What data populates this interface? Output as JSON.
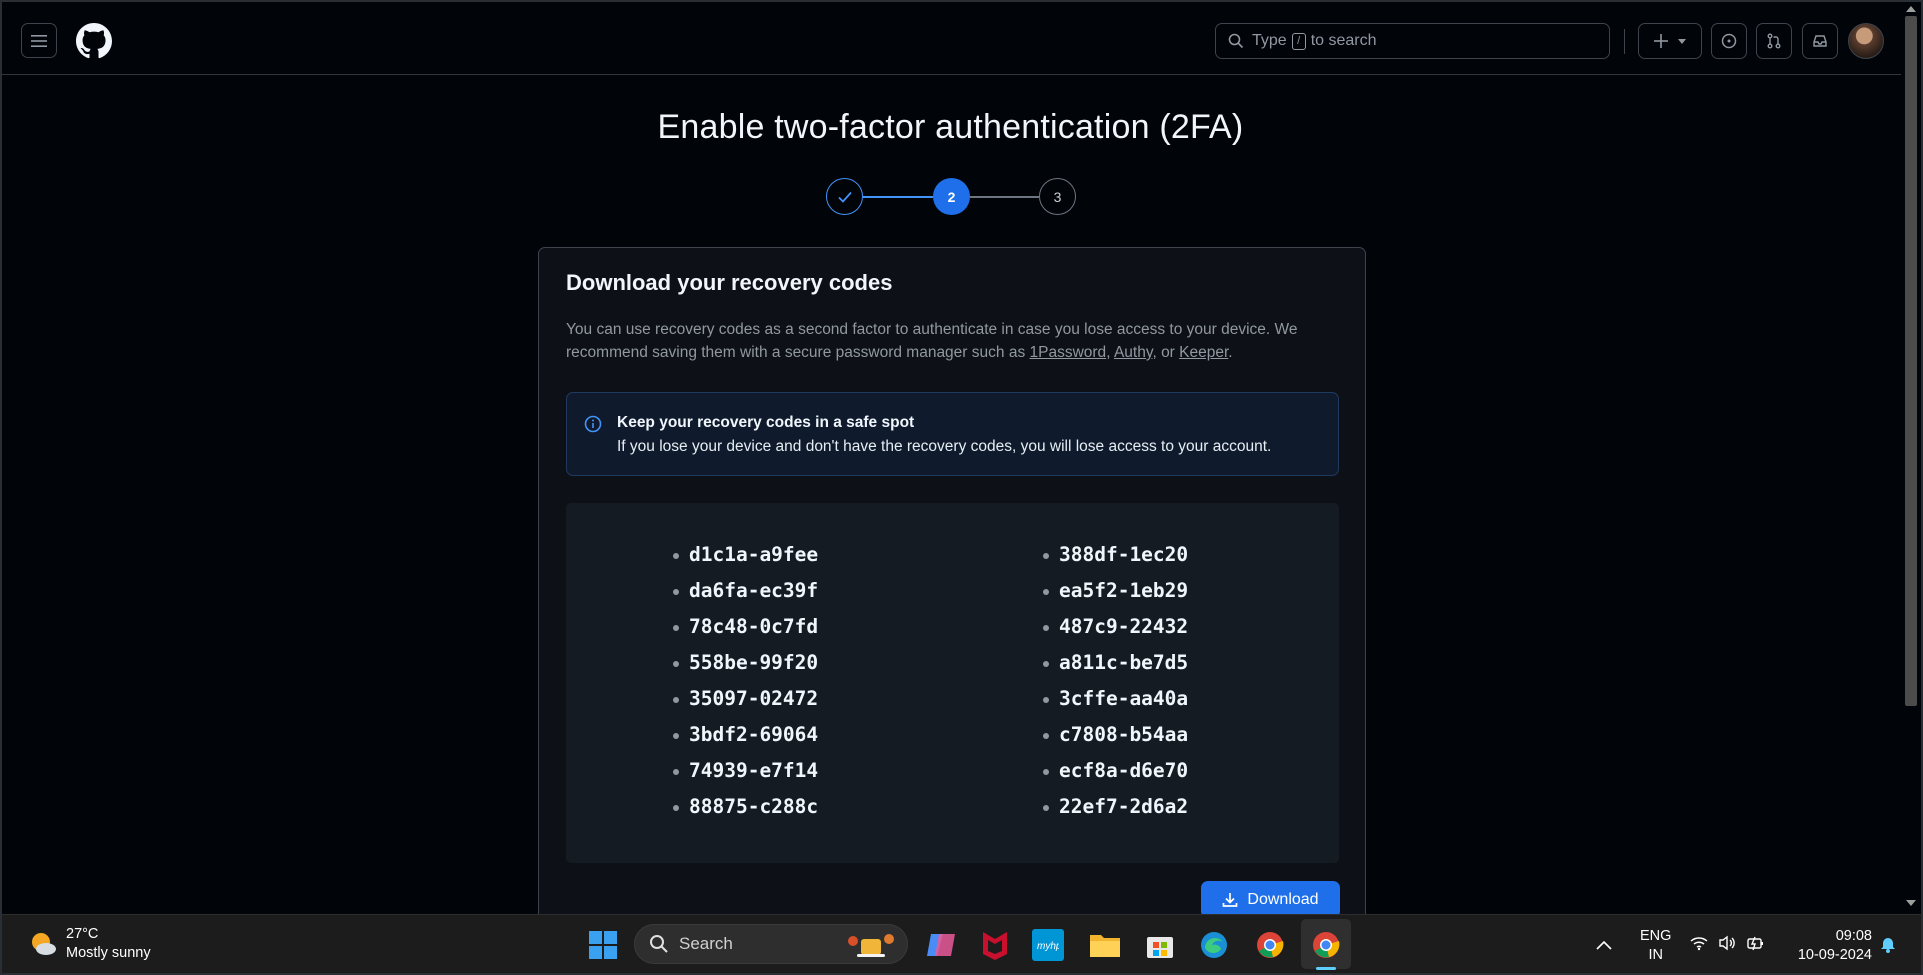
{
  "header": {
    "search_placeholder_pre": "Type",
    "search_slash": "/",
    "search_placeholder_post": "to search"
  },
  "page": {
    "title": "Enable two-factor authentication (2FA)",
    "steps": [
      {
        "label": "",
        "state": "completed"
      },
      {
        "label": "2",
        "state": "current"
      },
      {
        "label": "3",
        "state": "upcoming"
      }
    ]
  },
  "card": {
    "title": "Download your recovery codes",
    "desc_part1": "You can use recovery codes as a second factor to authenticate in case you lose access to your device. We recommend saving them with a secure password manager such as ",
    "link_1password": "1Password",
    "sep1": ", ",
    "link_authy": "Authy",
    "sep2": ", or ",
    "link_keeper": "Keeper",
    "desc_end": ".",
    "flash_title": "Keep your recovery codes in a safe spot",
    "flash_text": "If you lose your device and don't have the recovery codes, you will lose access to your account.",
    "codes_left": [
      "d1c1a-a9fee",
      "da6fa-ec39f",
      "78c48-0c7fd",
      "558be-99f20",
      "35097-02472",
      "3bdf2-69064",
      "74939-e7f14",
      "88875-c288c"
    ],
    "codes_right": [
      "388df-1ec20",
      "ea5f2-1eb29",
      "487c9-22432",
      "a811c-be7d5",
      "3cffe-aa40a",
      "c7808-b54aa",
      "ecf8a-d6e70",
      "22ef7-2d6a2"
    ],
    "download_label": "Download"
  },
  "taskbar": {
    "weather_temp": "27°C",
    "weather_desc": "Mostly sunny",
    "search_label": "Search",
    "lang_1": "ENG",
    "lang_2": "IN",
    "time": "09:08",
    "date": "10-09-2024"
  },
  "colors": {
    "accent": "#1f6feb",
    "background": "#010409",
    "card": "#0d1117"
  }
}
